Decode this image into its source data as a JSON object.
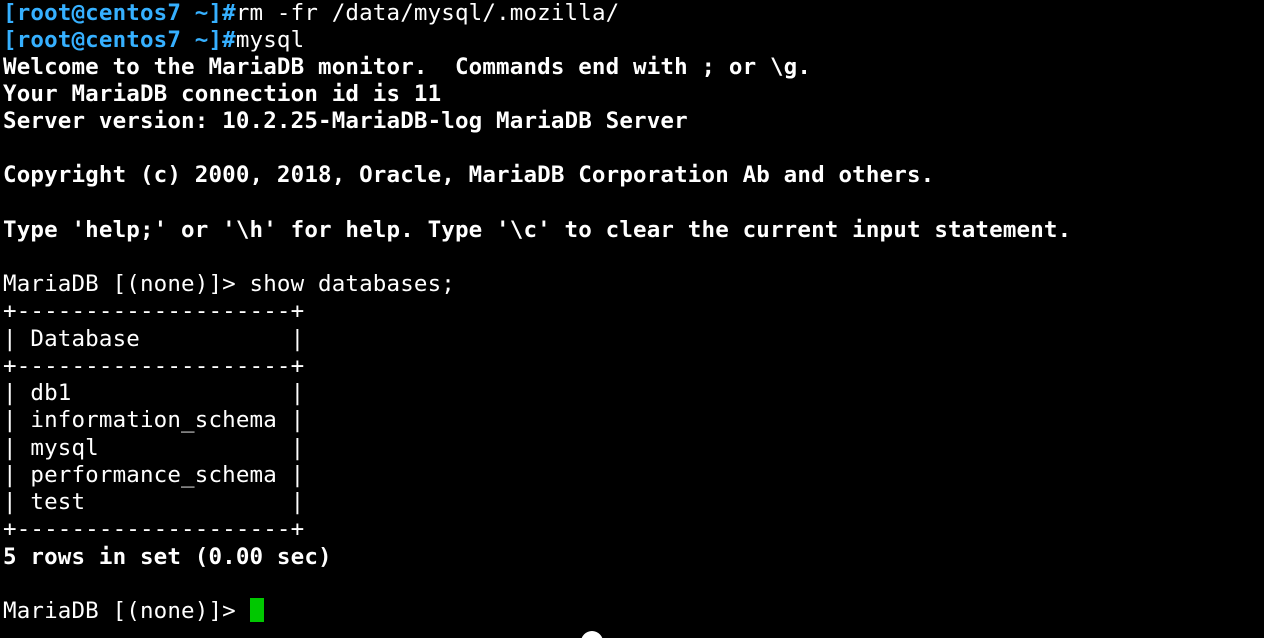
{
  "terminal": {
    "colors": {
      "background": "#000000",
      "foreground": "#ffffff",
      "prompt": "#36b0ff",
      "cursor": "#00c800"
    },
    "lines": [
      {
        "prompt": "[root@centos7 ~]#",
        "command": "rm -fr /data/mysql/.mozilla/"
      },
      {
        "prompt": "[root@centos7 ~]#",
        "command": "mysql"
      },
      {
        "text": "Welcome to the MariaDB monitor.  Commands end with ; or \\g."
      },
      {
        "text": "Your MariaDB connection id is 11"
      },
      {
        "text": "Server version: 10.2.25-MariaDB-log MariaDB Server"
      },
      {
        "text": ""
      },
      {
        "text": "Copyright (c) 2000, 2018, Oracle, MariaDB Corporation Ab and others."
      },
      {
        "text": ""
      },
      {
        "text": "Type 'help;' or '\\h' for help. Type '\\c' to clear the current input statement."
      },
      {
        "text": ""
      },
      {
        "text": "MariaDB [(none)]> show databases;"
      },
      {
        "text": "+--------------------+"
      },
      {
        "text": "| Database           |"
      },
      {
        "text": "+--------------------+"
      },
      {
        "text": "| db1                |"
      },
      {
        "text": "| information_schema |"
      },
      {
        "text": "| mysql              |"
      },
      {
        "text": "| performance_schema |"
      },
      {
        "text": "| test               |"
      },
      {
        "text": "+--------------------+"
      },
      {
        "text": "5 rows in set (0.00 sec)"
      },
      {
        "text": ""
      },
      {
        "text": "MariaDB [(none)]> "
      }
    ],
    "cursor_icon": "block-cursor-icon",
    "mouse_icon": "mouse-pointer-icon"
  }
}
